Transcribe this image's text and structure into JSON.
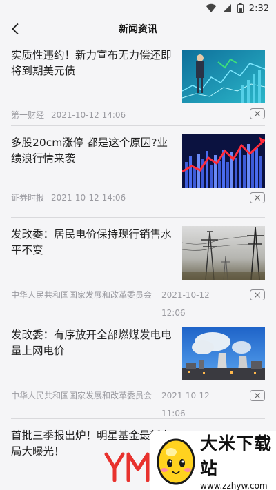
{
  "status": {
    "time": "2:32"
  },
  "header": {
    "title": "新闻资讯"
  },
  "news": [
    {
      "title": "实质性违约！新力宣布无力偿还即将到期美元债",
      "source": "第一财经",
      "date": "2021-10-12 14:06"
    },
    {
      "title": "多股20cm涨停 都是这个原因?业绩浪行情来袭",
      "source": "证券时报",
      "date": "2021-10-12 14:06"
    },
    {
      "title": "发改委：居民电价保持现行销售水平不变",
      "source": "中华人民共和国国家发展和改革委员会",
      "date": "2021-10-12 12:06"
    },
    {
      "title": "发改委：有序放开全部燃煤发电电量上网电价",
      "source": "中华人民共和国国家发展和改革委员会",
      "date": "2021-10-12 11:06"
    },
    {
      "title": "首批三季报出炉！明星基金最新布局大曝光！"
    }
  ],
  "watermark": {
    "name": "大米下载站",
    "url": "www.zzhyw.com"
  }
}
